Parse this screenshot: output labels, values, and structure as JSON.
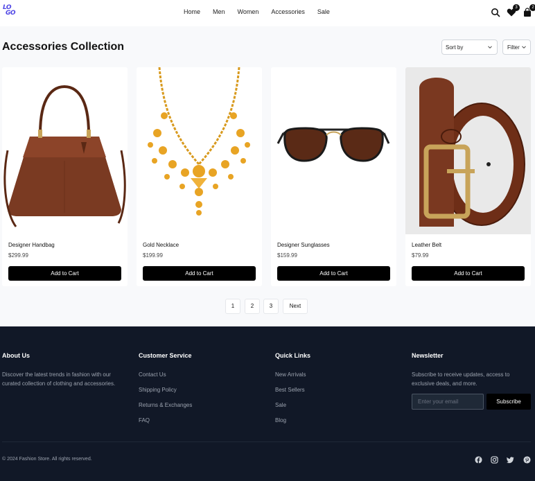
{
  "header": {
    "logo_line1": "LO",
    "logo_line2": "GO",
    "nav": [
      "Home",
      "Men",
      "Women",
      "Accessories",
      "Sale"
    ],
    "wishlist_count": "3",
    "cart_count": "2",
    "icons": [
      "search-icon",
      "heart-icon",
      "bag-icon"
    ]
  },
  "main": {
    "title": "Accessories Collection",
    "sort_label": "Sort by",
    "filter_label": "Filter",
    "products": [
      {
        "name": "Designer Handbag",
        "price": "$299.99",
        "button": "Add to Cart"
      },
      {
        "name": "Gold Necklace",
        "price": "$199.99",
        "button": "Add to Cart"
      },
      {
        "name": "Designer Sunglasses",
        "price": "$159.99",
        "button": "Add to Cart"
      },
      {
        "name": "Leather Belt",
        "price": "$79.99",
        "button": "Add to Cart"
      }
    ],
    "pagination": [
      "1",
      "2",
      "3",
      "Next"
    ]
  },
  "footer": {
    "about_title": "About Us",
    "about_text": "Discover the latest trends in fashion with our curated collection of clothing and accessories.",
    "service_title": "Customer Service",
    "service_links": [
      "Contact Us",
      "Shipping Policy",
      "Returns & Exchanges",
      "FAQ"
    ],
    "quick_title": "Quick Links",
    "quick_links": [
      "New Arrivals",
      "Best Sellers",
      "Sale",
      "Blog"
    ],
    "newsletter_title": "Newsletter",
    "newsletter_text": "Subscribe to receive updates, access to exclusive deals, and more.",
    "email_placeholder": "Enter your email",
    "subscribe_label": "Subscribe",
    "copyright": "© 2024 Fashion Store. All rights reserved.",
    "social_icons": [
      "facebook-icon",
      "instagram-icon",
      "twitter-icon",
      "pinterest-icon"
    ]
  },
  "colors": {
    "accent": "#4f46e5",
    "footer_bg": "#111827",
    "button_bg": "#000000",
    "page_bg": "#f8f9fb"
  }
}
